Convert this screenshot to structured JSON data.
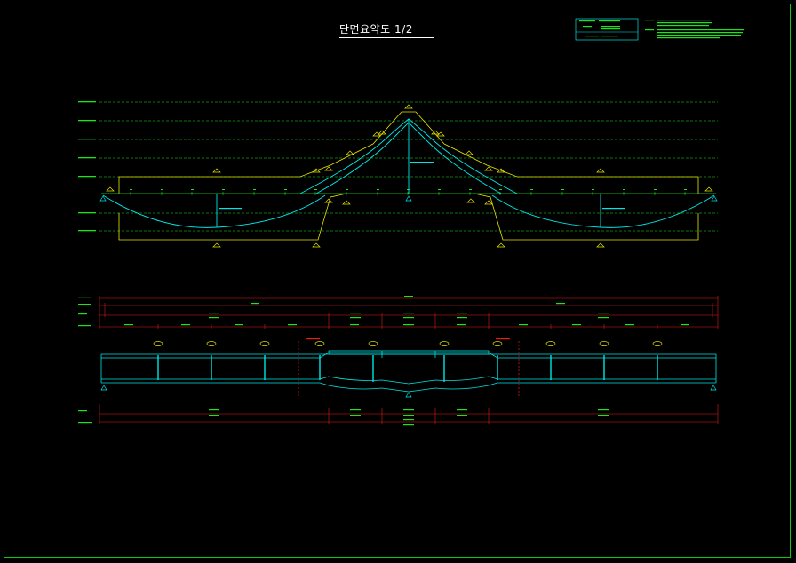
{
  "title": "단면요약도 1/2",
  "colors": {
    "background": "#000000",
    "frame": "#10c810",
    "green": "#19e619",
    "cyan": "#00e6e6",
    "yellow": "#e6e600",
    "red": "#e61919",
    "white": "#ffffff"
  },
  "icons": {
    "marker": "triangle-marker-icon",
    "support": "support-triangle-icon"
  }
}
